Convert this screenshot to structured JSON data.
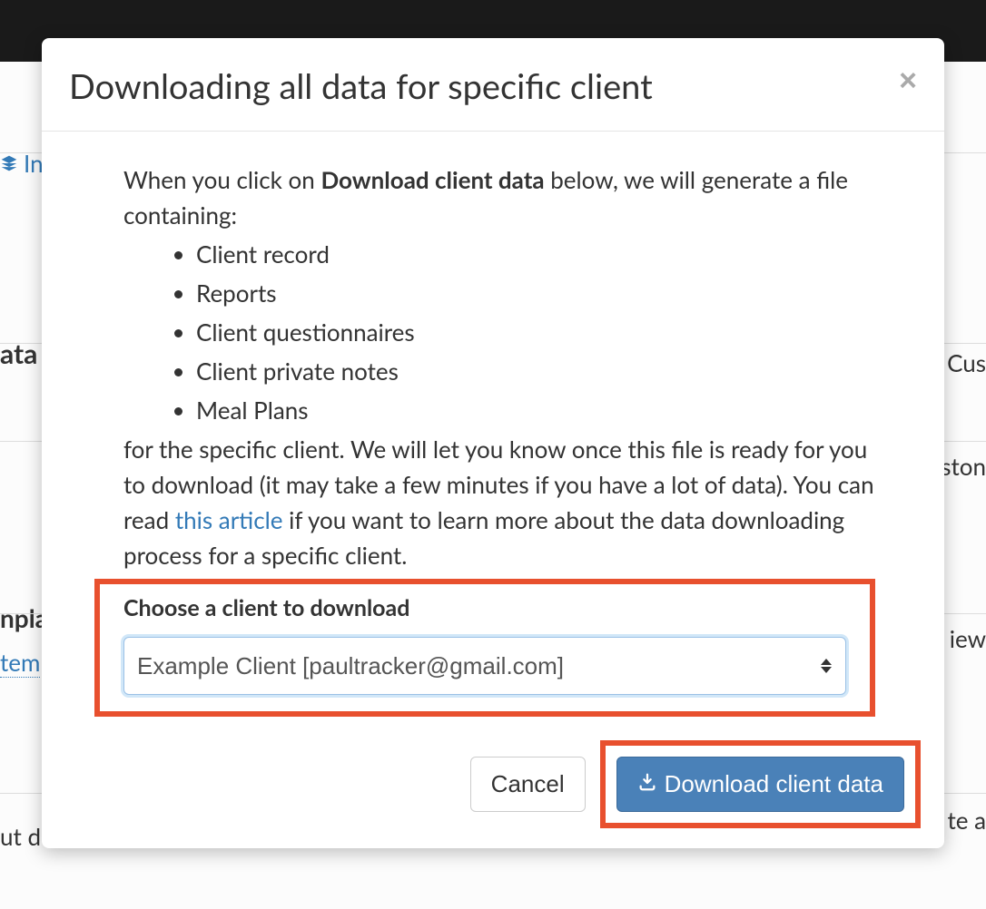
{
  "background": {
    "nav_label": "Int",
    "heading_left_1": "ata",
    "right_1": "Cus",
    "right_2": "ston",
    "right_3": "iew",
    "right_4": "te a",
    "heading_left_2": "npla",
    "link_left": "tem",
    "left_3": "ut de"
  },
  "modal": {
    "title": "Downloading all data for specific client",
    "intro_prefix": "When you click on ",
    "intro_bold": "Download client data",
    "intro_suffix": " below, we will generate a file containing:",
    "items": [
      "Client record",
      "Reports",
      "Client questionnaires",
      "Client private notes",
      "Meal Plans"
    ],
    "para2_prefix": "for the specific client. We will let you know once this file is ready for you to download (it may take a few minutes if you have a lot of data). You can read ",
    "para2_link": "this article",
    "para2_suffix": " if you want to learn more about the data downloading process for a specific client.",
    "form": {
      "label": "Choose a client to download",
      "selected": "Example Client [paultracker@gmail.com]"
    },
    "buttons": {
      "cancel": "Cancel",
      "download": "Download client data"
    }
  }
}
